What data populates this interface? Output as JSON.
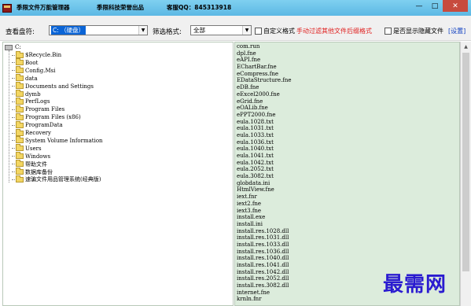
{
  "window": {
    "title_app": "季限文件万能管理器",
    "title_company": "季限科技荣誉出品",
    "title_qq": "客服QQ：845313918"
  },
  "toolbar": {
    "drive_label": "查看盘符:",
    "drive_value": "C: （硬盘）",
    "filter_label": "筛选格式:",
    "filter_value": "全部",
    "custom_format_label": "自定义格式",
    "manual_filter_text": "手动过滤其他文件后缀格式",
    "show_hidden_label": "是否显示隐藏文件",
    "settings_label": "[设置]"
  },
  "tree": {
    "root": "C:",
    "folders": [
      "$Recycle.Bin",
      "Boot",
      "Config.Msi",
      "data",
      "Documents and Settings",
      "dymb",
      "PerfLogs",
      "Program Files",
      "Program Files (x86)",
      "ProgramData",
      "Recovery",
      "System Volume Information",
      "Users",
      "Windows",
      "帮助文件",
      "数据库备份",
      "速骗文件用品管理系统(经典版)"
    ]
  },
  "files": [
    "com.run",
    "dpl.fne",
    "eAPI.fne",
    "EChartBar.fne",
    "eCompress.fne",
    "EDataStructure.fne",
    "eDB.fne",
    "eExcel2000.fne",
    "eGrid.fne",
    "eOALib.fne",
    "ePPT2000.fne",
    "eula.1028.txt",
    "eula.1031.txt",
    "eula.1033.txt",
    "eula.1036.txt",
    "eula.1040.txt",
    "eula.1041.txt",
    "eula.1042.txt",
    "eula.2052.txt",
    "eula.3082.txt",
    "globdata.ini",
    "HtmlView.fne",
    "iext.fnr",
    "iext2.fne",
    "iext3.fne",
    "install.exe",
    "install.ini",
    "install.res.1028.dll",
    "install.res.1031.dll",
    "install.res.1033.dll",
    "install.res.1036.dll",
    "install.res.1040.dll",
    "install.res.1041.dll",
    "install.res.1042.dll",
    "install.res.2052.dll",
    "install.res.3082.dll",
    "internet.fne",
    "krnln.fnr"
  ],
  "watermark": "最需网"
}
